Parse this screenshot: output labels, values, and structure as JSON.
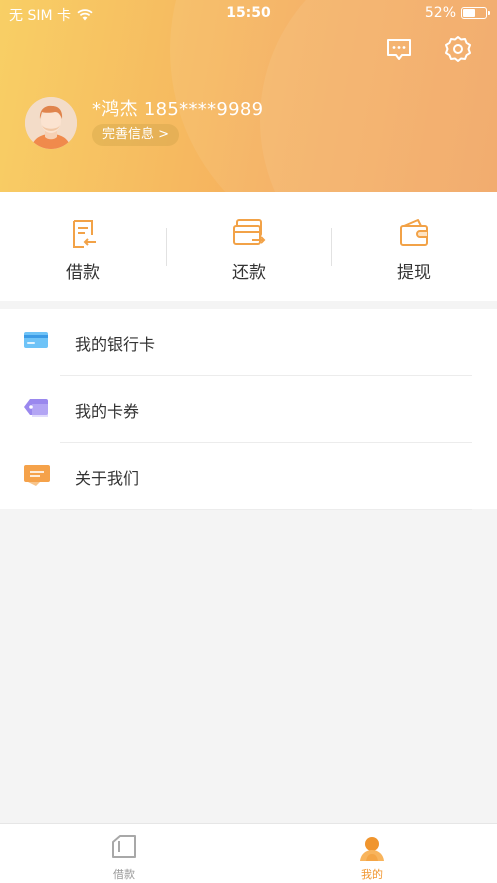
{
  "status_bar": {
    "carrier": "无 SIM 卡",
    "time": "15:50",
    "battery_percent_label": "52%",
    "battery_level": 0.52
  },
  "header": {
    "user_name": "*鸿杰 185****9989",
    "complete_info_label": "完善信息 >",
    "icons": [
      "message-icon",
      "settings-icon"
    ]
  },
  "actions": [
    {
      "label": "借款",
      "icon": "loan-doc-icon"
    },
    {
      "label": "还款",
      "icon": "repay-card-icon"
    },
    {
      "label": "提现",
      "icon": "wallet-icon"
    }
  ],
  "menu": [
    {
      "label": "我的银行卡",
      "icon": "bank-card-icon",
      "color": "#4aa9f0"
    },
    {
      "label": "我的卡券",
      "icon": "coupon-tag-icon",
      "color": "#8b78e6"
    },
    {
      "label": "关于我们",
      "icon": "about-message-icon",
      "color": "#f2a247"
    }
  ],
  "tabbar": {
    "tabs": [
      {
        "label": "借款",
        "icon": "loan-tab-icon",
        "active": false
      },
      {
        "label": "我的",
        "icon": "profile-tab-icon",
        "active": true
      }
    ]
  },
  "colors": {
    "accent": "#f2a247",
    "header_gradient_start": "#f8cf65",
    "header_gradient_end": "#f2a05a",
    "tab_inactive": "#999999",
    "tab_active": "#f0952e"
  }
}
